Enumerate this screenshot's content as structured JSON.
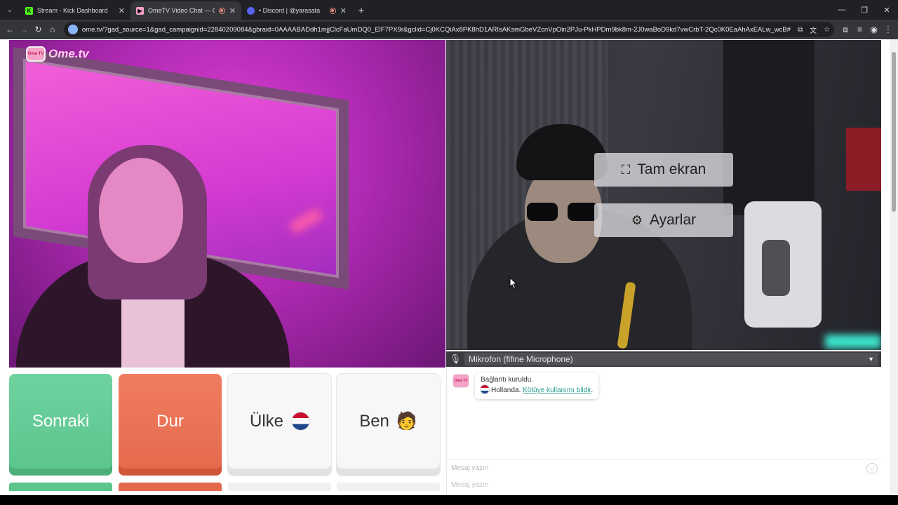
{
  "browser": {
    "tabs": [
      {
        "title": "Stream - Kick Dashboard",
        "favicon": "kick-icon",
        "color": "#53fc18"
      },
      {
        "title": "OmeTV Video Chat — Ome",
        "favicon": "ometv-icon",
        "color": "#f5a3c9",
        "active": true,
        "recording": true
      },
      {
        "title": "• Discord | @yarasata",
        "favicon": "discord-icon",
        "color": "#5865f2",
        "recording": true
      }
    ],
    "url": "ome.tv/?gad_source=1&gad_campaignid=22840209084&gbraid=0AAAABADdh1mjjClcFaUmDQ0_ElF7PX9r&gclid=Cj0KCQiAx8PK8hD1ARIsAKsmGbeVZcnVpOin2PJu-PkHPDm9bk8m-2J0waBoD9kd7vwCrbT-2Qc0K0EaAhAxEALw_wcB#"
  },
  "app": {
    "logo_text": "Ome.tv",
    "logo_badge": "Ome TV"
  },
  "self_video": {
    "fullscreen_label": "Tam ekran",
    "settings_label": "Ayarlar",
    "mic_selected": "Mikrofon (fifine Microphone)"
  },
  "buttons": {
    "next_label": "Sonraki",
    "stop_label": "Dur",
    "country_label": "Ülke",
    "me_label": "Ben",
    "me_emoji": "🧑"
  },
  "chat": {
    "status_line": "Bağlantı kuruldu.",
    "country_name": "Hollanda.",
    "report_link": "Kötüye kullanımı bildir",
    "report_suffix": ".",
    "input_placeholder": "Mesaj yazın",
    "ghost_placeholder": "Mesaj yazın"
  },
  "colors": {
    "next_green": "#5cc48d",
    "stop_orange": "#e4694c",
    "link_teal": "#2a9d8f"
  }
}
